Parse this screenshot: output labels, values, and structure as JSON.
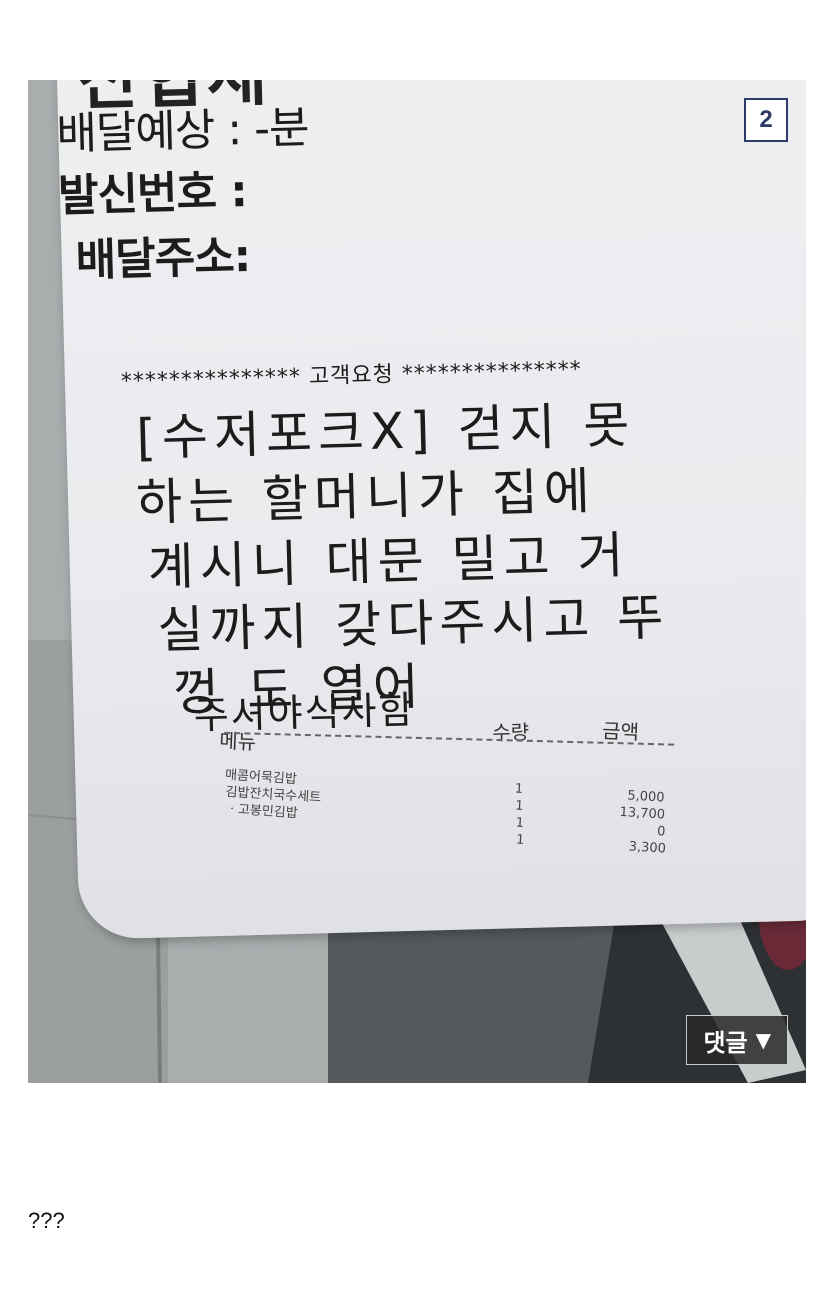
{
  "photo": {
    "receipt": {
      "top_title": "신협세",
      "fields": [
        "배달예상 : -분",
        "발신번호 :",
        "배달주소:"
      ],
      "request_title": "*************** 고객요청 ***************",
      "request_lines": [
        "[수저포크X] 걷지 못",
        "하는 할머니가 집에",
        "계시니  대문 밀고 거",
        "실까지 갖다주시고 뚜",
        "껑       도 열어",
        "주셔야식사함"
      ],
      "table": {
        "headers": {
          "menu": "메뉴",
          "qty": "수량",
          "amount": "금액"
        },
        "rows": [
          {
            "name": "매콤어묵김밥",
            "qty": "1",
            "amount": "5,000"
          },
          {
            "name": "김밥잔치국수세트",
            "qty": "1",
            "amount": "13,700"
          },
          {
            "name": "ㆍ고봉민김밥",
            "qty": "1",
            "amount": "0"
          },
          {
            "name": "",
            "qty": "1",
            "amount": "3,300"
          }
        ]
      }
    },
    "page_badge": "2",
    "comment_button": {
      "label": "댓글",
      "icon": "triangle-down-icon"
    }
  },
  "post_text": "???"
}
